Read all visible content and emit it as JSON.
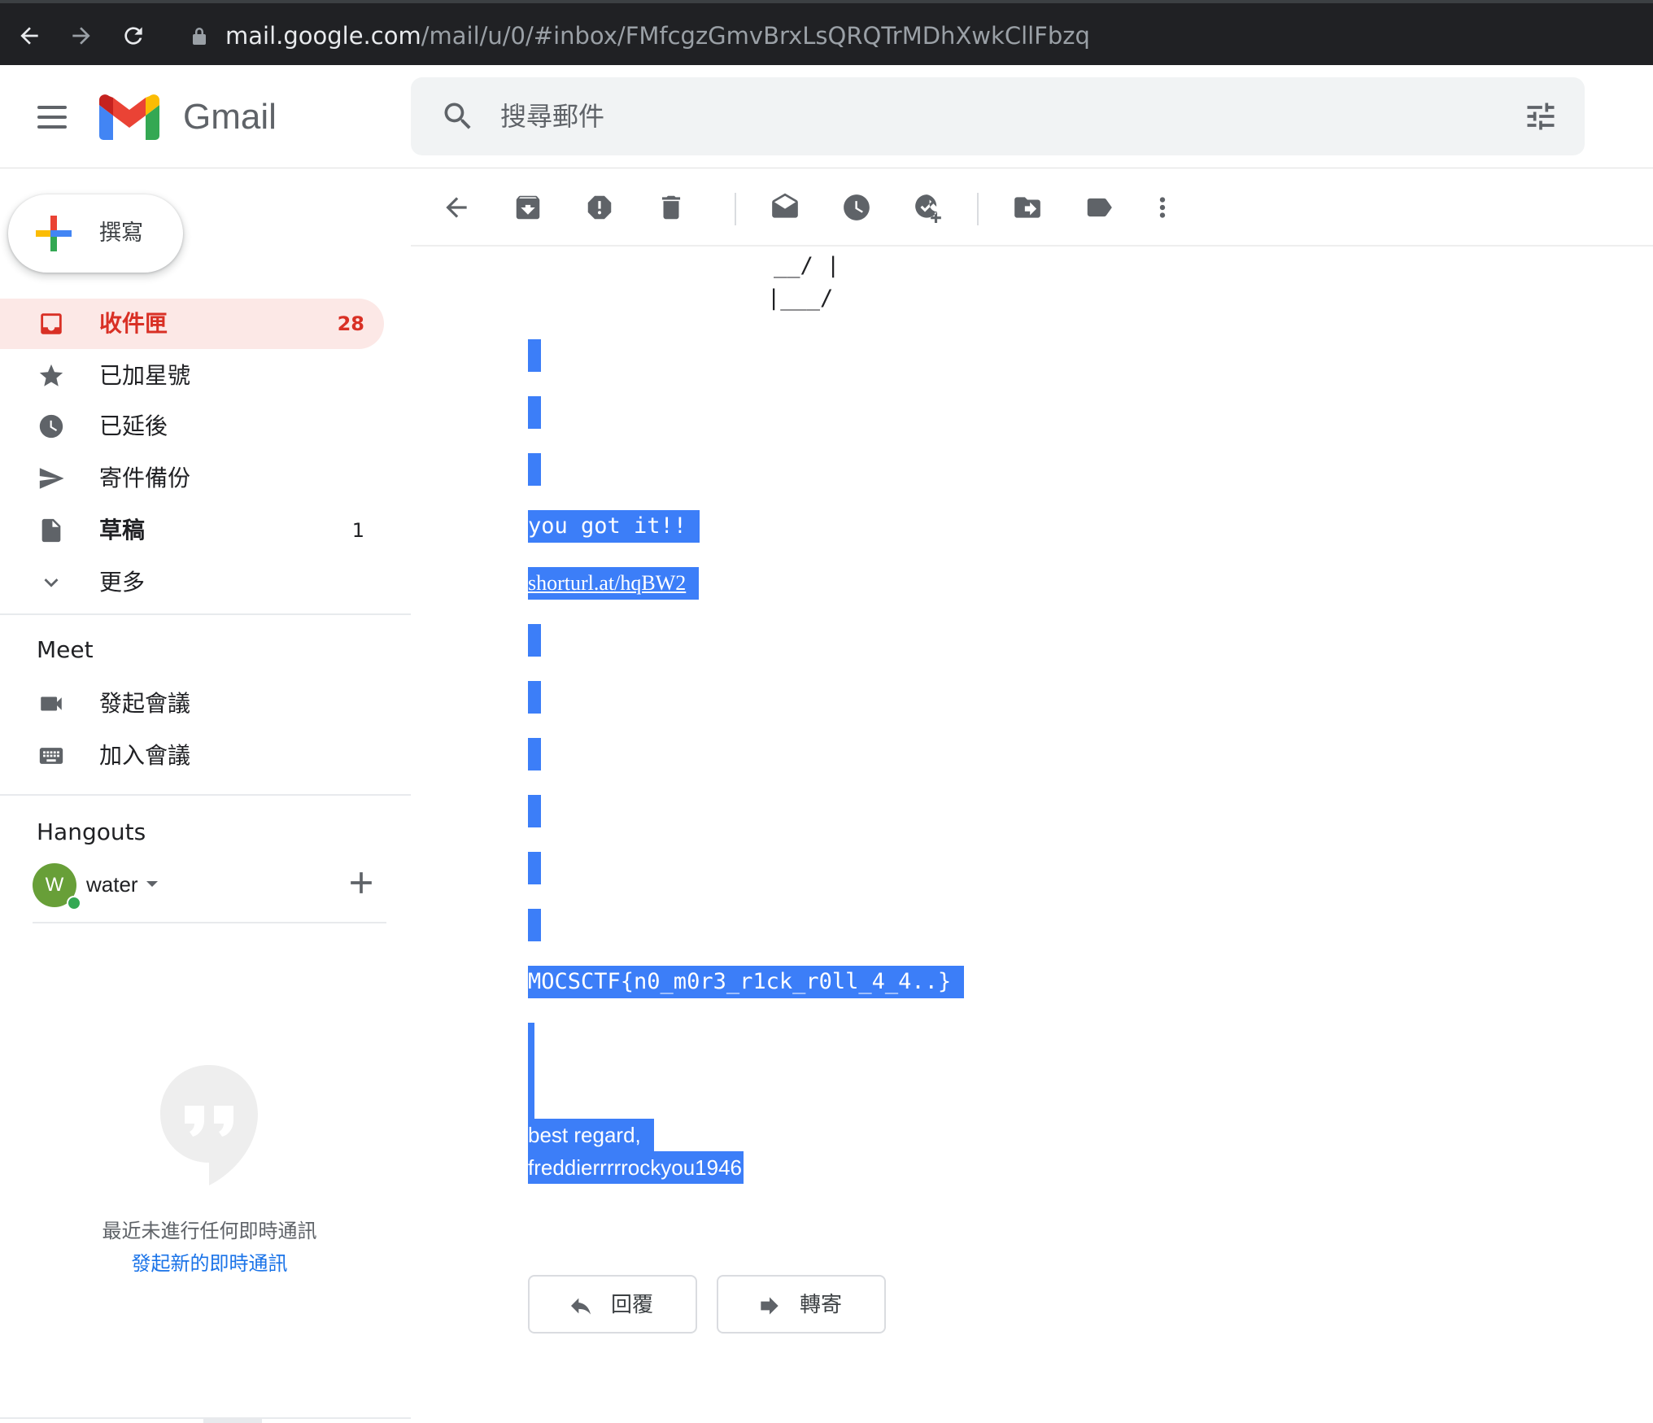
{
  "browser": {
    "url_host": "mail.google.com",
    "url_path": "/mail/u/0/#inbox/FMfcgzGmvBrxLsQRQTrMDhXwkCllFbzq"
  },
  "app": {
    "name": "Gmail"
  },
  "search": {
    "placeholder": "搜尋郵件"
  },
  "compose": {
    "label": "撰寫"
  },
  "nav": {
    "items": [
      {
        "label": "收件匣",
        "count": "28",
        "icon": "inbox-icon",
        "active": true
      },
      {
        "label": "已加星號",
        "count": "",
        "icon": "star-icon"
      },
      {
        "label": "已延後",
        "count": "",
        "icon": "clock-icon"
      },
      {
        "label": "寄件備份",
        "count": "",
        "icon": "send-icon"
      },
      {
        "label": "草稿",
        "count": "1",
        "icon": "draft-icon"
      },
      {
        "label": "更多",
        "count": "",
        "icon": "chevron-down-icon"
      }
    ]
  },
  "meet": {
    "title": "Meet",
    "items": [
      {
        "label": "發起會議",
        "icon": "video-camera-icon"
      },
      {
        "label": "加入會議",
        "icon": "keyboard-icon"
      }
    ]
  },
  "hangouts": {
    "title": "Hangouts",
    "user_initial": "W",
    "user_name": "water",
    "empty_text": "最近未進行任何即時通訊",
    "start_link": "發起新的即時通訊"
  },
  "toolbar": {
    "icons": [
      "back-arrow-icon",
      "archive-icon",
      "report-spam-icon",
      "delete-icon",
      "mark-unread-icon",
      "snooze-icon",
      "add-to-tasks-icon",
      "move-to-icon",
      "label-icon",
      "more-vert-icon"
    ]
  },
  "message": {
    "ascii_line1": "__/ |",
    "ascii_line2": "|___/",
    "line_you_got_it": "you got it!!",
    "line_link": "shorturl.at/hqBW2",
    "line_flag": "MOCSCTF{n0_m0r3_r1ck_r0ll_4_4..}",
    "line_regard": "best regard,",
    "line_signature": "freddierrrrrockyou1946"
  },
  "actions": {
    "reply_label": "回覆",
    "forward_label": "轉寄"
  },
  "colors": {
    "selection": "#3c7ef8",
    "active_nav_bg": "#fce8e6",
    "active_nav_text": "#d93025",
    "avatar": "#689f38"
  }
}
